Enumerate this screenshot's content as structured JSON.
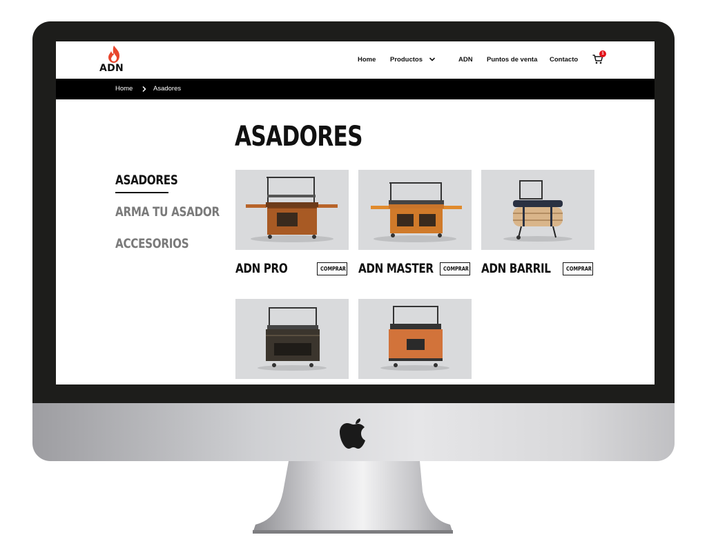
{
  "brand": {
    "name": "ADN",
    "accent": "#e8452c"
  },
  "nav": {
    "items": [
      {
        "label": "Home"
      },
      {
        "label": "Productos",
        "has_dropdown": true
      },
      {
        "label": "ADN"
      },
      {
        "label": "Puntos de venta"
      },
      {
        "label": "Contacto"
      }
    ],
    "cart_icon": "cart-icon",
    "cart_count": "1"
  },
  "breadcrumb": [
    "Home",
    "Asadores"
  ],
  "page_title": "ASADORES",
  "sidebar": {
    "items": [
      {
        "label": "ASADORES",
        "active": true
      },
      {
        "label": "ARMA TU ASADOR",
        "active": false
      },
      {
        "label": "ACCESORIOS",
        "active": false
      }
    ]
  },
  "products": [
    {
      "name": "ADN PRO",
      "button": "COMPRAR",
      "finish": "wood"
    },
    {
      "name": "ADN MASTER",
      "button": "COMPRAR",
      "finish": "light-wood"
    },
    {
      "name": "ADN BARRIL",
      "button": "COMPRAR",
      "finish": "barrel"
    },
    {
      "name": "",
      "button": "",
      "finish": "dark-wood"
    },
    {
      "name": "",
      "button": "",
      "finish": "orange"
    }
  ]
}
